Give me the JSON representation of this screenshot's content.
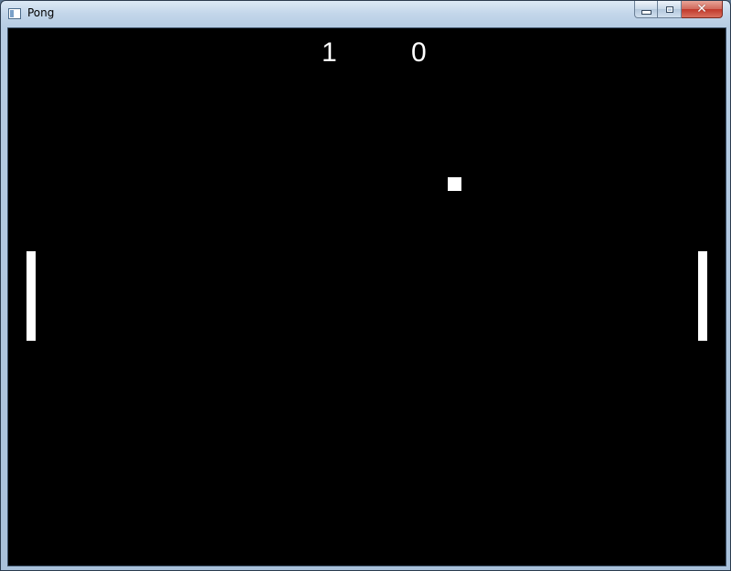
{
  "window": {
    "title": "Pong",
    "controls": {
      "minimize_icon": "minimize-icon",
      "maximize_icon": "maximize-icon",
      "close_icon": "close-icon",
      "close_glyph": "✕"
    }
  },
  "game": {
    "score_left": "1",
    "score_right": "0",
    "background_color": "#000000",
    "foreground_color": "#ffffff"
  }
}
